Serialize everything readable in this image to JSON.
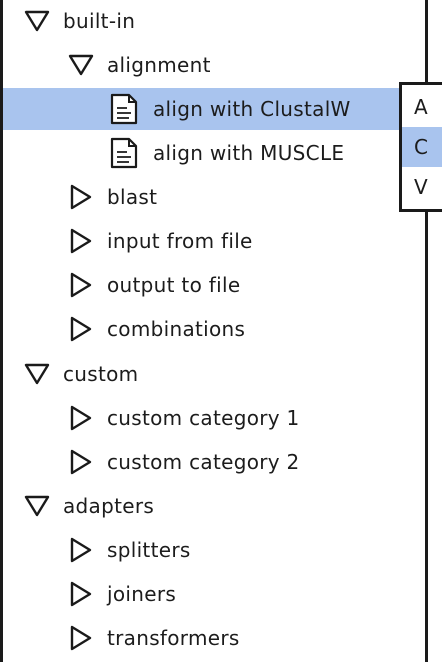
{
  "tree": {
    "nodes": [
      {
        "label": "built-in",
        "kind": "category",
        "expanded": true
      },
      {
        "label": "alignment",
        "kind": "category",
        "expanded": true
      },
      {
        "label": "align with ClustalW",
        "kind": "item",
        "selected": true
      },
      {
        "label": "align with MUSCLE",
        "kind": "item"
      },
      {
        "label": "blast",
        "kind": "category",
        "expanded": false
      },
      {
        "label": "input from file",
        "kind": "category",
        "expanded": false
      },
      {
        "label": "output to file",
        "kind": "category",
        "expanded": false
      },
      {
        "label": "combinations",
        "kind": "category",
        "expanded": false
      },
      {
        "label": "custom",
        "kind": "category",
        "expanded": true
      },
      {
        "label": "custom category 1",
        "kind": "category",
        "expanded": false
      },
      {
        "label": "custom category 2",
        "kind": "category",
        "expanded": false
      },
      {
        "label": "adapters",
        "kind": "category",
        "expanded": true
      },
      {
        "label": "splitters",
        "kind": "category",
        "expanded": false
      },
      {
        "label": "joiners",
        "kind": "category",
        "expanded": false
      },
      {
        "label": "transformers",
        "kind": "category",
        "expanded": false
      }
    ]
  },
  "context_menu": {
    "items": [
      {
        "label": "A"
      },
      {
        "label": "C",
        "highlighted": true
      },
      {
        "label": "V"
      }
    ]
  },
  "colors": {
    "selection": "#a9c4ee",
    "stroke": "#1a1a1a",
    "background": "#ffffff"
  },
  "icons": {
    "expanded": "triangle-down-icon",
    "collapsed": "triangle-right-icon",
    "item": "document-icon"
  }
}
